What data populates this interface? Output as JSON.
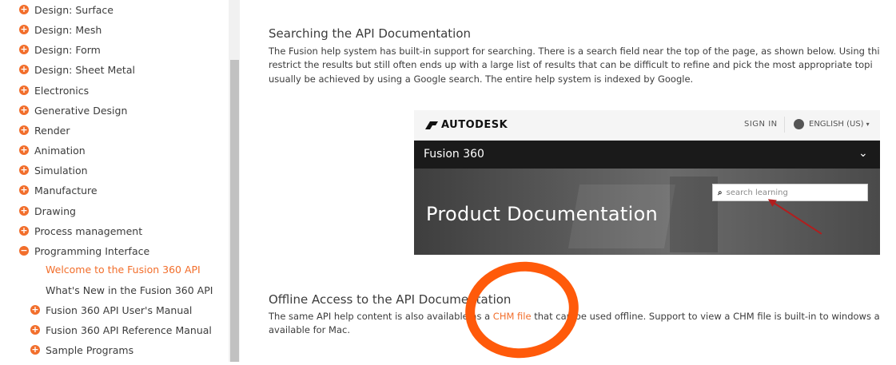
{
  "sidebar": {
    "items": [
      {
        "label": "Design: Surface",
        "icon": "plus-circle-icon"
      },
      {
        "label": "Design: Mesh",
        "icon": "plus-circle-icon"
      },
      {
        "label": "Design: Form",
        "icon": "plus-circle-icon"
      },
      {
        "label": "Design: Sheet Metal",
        "icon": "plus-circle-icon"
      },
      {
        "label": "Electronics",
        "icon": "plus-circle-icon"
      },
      {
        "label": "Generative Design",
        "icon": "plus-circle-icon"
      },
      {
        "label": "Render",
        "icon": "plus-circle-icon"
      },
      {
        "label": "Animation",
        "icon": "plus-circle-icon"
      },
      {
        "label": "Simulation",
        "icon": "plus-circle-icon"
      },
      {
        "label": "Manufacture",
        "icon": "plus-circle-icon"
      },
      {
        "label": "Drawing",
        "icon": "plus-circle-icon"
      },
      {
        "label": "Process management",
        "icon": "plus-circle-icon"
      },
      {
        "label": "Programming Interface",
        "icon": "minus-circle-icon"
      }
    ],
    "subitems": [
      {
        "label": "Welcome to the Fusion 360 API",
        "active": true
      },
      {
        "label": "What's New in the Fusion 360 API",
        "active": false
      },
      {
        "label": "Fusion 360 API User's Manual",
        "icon": "plus-circle-icon"
      },
      {
        "label": "Fusion 360 API Reference Manual",
        "icon": "plus-circle-icon"
      },
      {
        "label": "Sample Programs",
        "icon": "plus-circle-icon"
      }
    ]
  },
  "content": {
    "section1": {
      "heading": "Searching the API Documentation",
      "line1": "The Fusion help system has built-in support for searching. There is a search field near the top of the page, as shown below. Using thi",
      "line2": "restrict the results but still often ends up with a large list of results that can be difficult to refine and pick the most appropriate topi",
      "line3": "usually be achieved by using a Google search. The entire help system is indexed by Google."
    },
    "screenshot": {
      "brand": "AUTODESK",
      "sign_in": "SIGN IN",
      "language": "ENGLISH (US)",
      "product": "Fusion 360",
      "hero_title": "Product Documentation",
      "search_placeholder": "search learning"
    },
    "section2": {
      "heading": "Offline Access to the API Documentation",
      "line1_pre": "The same API help content is also available as a ",
      "link": "CHM file",
      "line1_post": " that can be used offline. Support to view a CHM file is built-in to windows a",
      "line2": "available for Mac."
    }
  },
  "colors": {
    "accent": "#f26e2b",
    "annotation": "#ff5a0a",
    "arrow": "#b21e1e"
  }
}
